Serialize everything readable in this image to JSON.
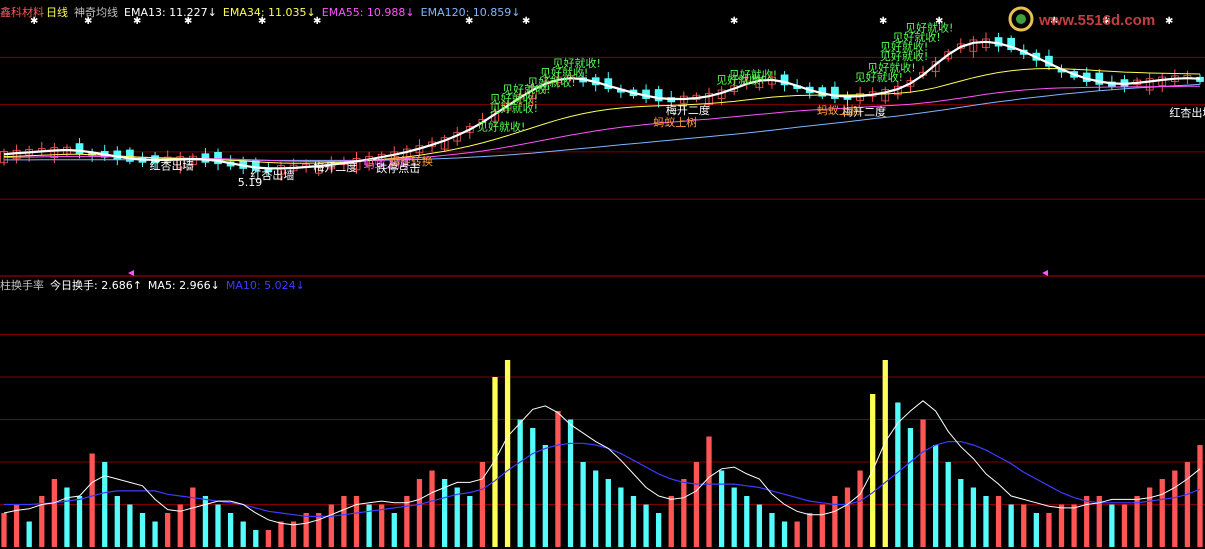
{
  "header_top": {
    "stock_name": "鑫科材料",
    "period": "日线",
    "indicator": "神奇均线",
    "ema13": "EMA13: 11.227↓",
    "ema34": "EMA34: 11.035↓",
    "ema55": "EMA55: 10.988↓",
    "ema120": "EMA120: 10.859↓"
  },
  "header_bottom": {
    "title": "柱换手率",
    "today": "今日换手: 2.686↑",
    "ma5": "MA5: 2.966↓",
    "ma10": "MA10: 5.024↓"
  },
  "watermark": {
    "text": "www.5516d.com"
  },
  "colors": {
    "up": "#ff5555",
    "down": "#54fcfc",
    "ema13": "#ffffff",
    "ema34": "#ffff54",
    "ema55": "#ff54ff",
    "ema120": "#7fb6ff",
    "signal_green": "#54fc54",
    "signal_white": "#ffffff",
    "signal_orange": "#ff9c3c",
    "signal_magenta": "#ff54ff",
    "grid": "#800000",
    "vol_ma5": "#ffffff",
    "vol_ma10": "#3c3cff",
    "vol_high": "#ffff54"
  },
  "chart_data": [
    {
      "type": "candlestick",
      "title": "",
      "ylim": [
        5.0,
        15.5
      ],
      "ema13": [
        9.9,
        9.95,
        9.98,
        10.02,
        10.06,
        10.08,
        10.05,
        9.98,
        9.9,
        9.8,
        9.72,
        9.68,
        9.66,
        9.66,
        9.68,
        9.7,
        9.68,
        9.62,
        9.52,
        9.42,
        9.34,
        9.3,
        9.3,
        9.32,
        9.36,
        9.4,
        9.46,
        9.52,
        9.6,
        9.68,
        9.78,
        9.88,
        10.0,
        10.14,
        10.3,
        10.48,
        10.7,
        10.95,
        11.25,
        11.6,
        11.95,
        12.3,
        12.62,
        12.88,
        13.05,
        13.12,
        13.08,
        12.96,
        12.8,
        12.65,
        12.5,
        12.38,
        12.28,
        12.24,
        12.24,
        12.28,
        12.36,
        12.5,
        12.68,
        12.88,
        13.02,
        13.05,
        12.96,
        12.8,
        12.62,
        12.48,
        12.38,
        12.34,
        12.36,
        12.42,
        12.52,
        12.66,
        12.9,
        13.25,
        13.7,
        14.12,
        14.45,
        14.62,
        14.66,
        14.6,
        14.45,
        14.25,
        14.0,
        13.75,
        13.5,
        13.28,
        13.1,
        12.98,
        12.9,
        12.88,
        12.92,
        12.98,
        13.05,
        13.1,
        13.12,
        13.1
      ],
      "ema34": [
        9.8,
        9.82,
        9.84,
        9.86,
        9.88,
        9.9,
        9.9,
        9.88,
        9.86,
        9.83,
        9.8,
        9.77,
        9.75,
        9.73,
        9.72,
        9.71,
        9.7,
        9.68,
        9.65,
        9.62,
        9.58,
        9.55,
        9.53,
        9.52,
        9.52,
        9.53,
        9.55,
        9.57,
        9.6,
        9.64,
        9.68,
        9.73,
        9.79,
        9.86,
        9.94,
        10.03,
        10.13,
        10.25,
        10.38,
        10.53,
        10.69,
        10.86,
        11.03,
        11.2,
        11.36,
        11.5,
        11.62,
        11.72,
        11.8,
        11.86,
        11.9,
        11.93,
        11.95,
        11.97,
        11.99,
        12.02,
        12.05,
        12.09,
        12.14,
        12.2,
        12.26,
        12.32,
        12.36,
        12.39,
        12.4,
        12.41,
        12.41,
        12.41,
        12.42,
        12.43,
        12.45,
        12.48,
        12.53,
        12.61,
        12.72,
        12.86,
        13.0,
        13.14,
        13.26,
        13.36,
        13.44,
        13.49,
        13.52,
        13.53,
        13.52,
        13.5,
        13.47,
        13.44,
        13.41,
        13.38,
        13.36,
        13.34,
        13.33,
        13.32,
        13.31,
        13.3
      ],
      "ema55": [
        9.76,
        9.77,
        9.78,
        9.79,
        9.8,
        9.81,
        9.81,
        9.81,
        9.8,
        9.79,
        9.78,
        9.77,
        9.76,
        9.75,
        9.74,
        9.73,
        9.72,
        9.71,
        9.7,
        9.68,
        9.66,
        9.64,
        9.62,
        9.61,
        9.6,
        9.6,
        9.6,
        9.61,
        9.62,
        9.64,
        9.66,
        9.69,
        9.72,
        9.76,
        9.8,
        9.85,
        9.91,
        9.97,
        10.04,
        10.12,
        10.21,
        10.31,
        10.41,
        10.51,
        10.61,
        10.71,
        10.8,
        10.89,
        10.97,
        11.04,
        11.1,
        11.16,
        11.21,
        11.26,
        11.3,
        11.35,
        11.39,
        11.44,
        11.49,
        11.54,
        11.59,
        11.64,
        11.69,
        11.73,
        11.77,
        11.8,
        11.83,
        11.86,
        11.89,
        11.92,
        11.95,
        11.98,
        12.02,
        12.07,
        12.13,
        12.2,
        12.28,
        12.36,
        12.44,
        12.51,
        12.57,
        12.62,
        12.66,
        12.69,
        12.71,
        12.72,
        12.73,
        12.74,
        12.75,
        12.75,
        12.76,
        12.76,
        12.77,
        12.77,
        12.78,
        12.78
      ],
      "ema120": [
        9.66,
        9.66,
        9.66,
        9.67,
        9.67,
        9.67,
        9.67,
        9.67,
        9.67,
        9.67,
        9.67,
        9.67,
        9.67,
        9.66,
        9.66,
        9.66,
        9.66,
        9.66,
        9.65,
        9.65,
        9.65,
        9.64,
        9.64,
        9.64,
        9.64,
        9.64,
        9.64,
        9.64,
        9.64,
        9.65,
        9.65,
        9.66,
        9.67,
        9.68,
        9.7,
        9.72,
        9.74,
        9.77,
        9.8,
        9.83,
        9.87,
        9.91,
        9.95,
        10.0,
        10.05,
        10.1,
        10.15,
        10.2,
        10.25,
        10.3,
        10.35,
        10.4,
        10.45,
        10.5,
        10.55,
        10.6,
        10.65,
        10.7,
        10.75,
        10.8,
        10.86,
        10.92,
        10.98,
        11.04,
        11.1,
        11.16,
        11.22,
        11.28,
        11.34,
        11.4,
        11.46,
        11.52,
        11.59,
        11.66,
        11.73,
        11.81,
        11.89,
        11.97,
        12.05,
        12.12,
        12.19,
        12.26,
        12.32,
        12.38,
        12.44,
        12.49,
        12.54,
        12.59,
        12.63,
        12.67,
        12.71,
        12.74,
        12.77,
        12.8,
        12.83,
        12.86
      ],
      "annotations": [
        {
          "text": "见好就收!",
          "color": "green",
          "i": 45,
          "y": 13.6
        },
        {
          "text": "见好就收!",
          "color": "green",
          "i": 44,
          "y": 13.2
        },
        {
          "text": "见好就收!",
          "color": "green",
          "i": 43,
          "y": 12.8
        },
        {
          "text": "见好就收!",
          "color": "green",
          "i": 41,
          "y": 12.5
        },
        {
          "text": "见好就收!",
          "color": "green",
          "i": 40,
          "y": 12.1
        },
        {
          "text": "见好就收!",
          "color": "green",
          "i": 40,
          "y": 11.7
        },
        {
          "text": "见好就收!",
          "color": "green",
          "i": 39,
          "y": 10.9
        },
        {
          "text": "见好就收!",
          "color": "green",
          "i": 59,
          "y": 13.1
        },
        {
          "text": "见好就收!",
          "color": "green",
          "i": 58,
          "y": 12.9
        },
        {
          "text": "见好就收!",
          "color": "green",
          "i": 73,
          "y": 15.1
        },
        {
          "text": "见好就收!",
          "color": "green",
          "i": 72,
          "y": 14.7
        },
        {
          "text": "见好就收!",
          "color": "green",
          "i": 71,
          "y": 14.3
        },
        {
          "text": "见好就收!",
          "color": "green",
          "i": 71,
          "y": 13.9
        },
        {
          "text": "见好就收!",
          "color": "green",
          "i": 70,
          "y": 13.4
        },
        {
          "text": "见好就收!",
          "color": "green",
          "i": 69,
          "y": 13.0
        },
        {
          "text": "红杏出墙",
          "color": "white",
          "i": 13,
          "y": 9.25
        },
        {
          "text": "红杏出墙",
          "color": "white",
          "i": 21,
          "y": 8.85
        },
        {
          "text": "梅开二度",
          "color": "white",
          "i": 26,
          "y": 9.2
        },
        {
          "text": "梅开二度",
          "color": "white",
          "i": 54,
          "y": 11.6
        },
        {
          "text": "梅开二度",
          "color": "white",
          "i": 68,
          "y": 11.55
        },
        {
          "text": "红杏出墙",
          "color": "white",
          "i": 94,
          "y": 11.5
        },
        {
          "text": "梅开二度",
          "color": "white",
          "i": 98,
          "y": 12.3
        },
        {
          "text": "红杏出墙",
          "color": "white",
          "i": 98,
          "y": 11.9
        },
        {
          "text": "蚂蚁上树",
          "color": "orange",
          "i": 53,
          "y": 11.1
        },
        {
          "text": "蚂蚁上树",
          "color": "orange",
          "i": 66,
          "y": 11.6
        },
        {
          "text": "蚂蚁上树",
          "color": "orange",
          "i": 101,
          "y": 12.5
        },
        {
          "text": "蚂蚁上树",
          "color": "magenta",
          "i": 30,
          "y": 9.35
        },
        {
          "text": "螺旋转换",
          "color": "orange",
          "i": 32,
          "y": 9.45
        },
        {
          "text": "跌停点击",
          "color": "white",
          "i": 31,
          "y": 9.15
        },
        {
          "text": "5.19",
          "color": "white",
          "i": 20,
          "y": 8.55
        }
      ]
    },
    {
      "type": "bar",
      "title": "",
      "ylim": [
        0,
        30
      ],
      "values": [
        4,
        5,
        3,
        6,
        8,
        7,
        6,
        11,
        10,
        6,
        5,
        4,
        3,
        4,
        5,
        7,
        6,
        5,
        4,
        3,
        2,
        2,
        3,
        3,
        4,
        4,
        5,
        6,
        6,
        5,
        5,
        4,
        6,
        8,
        9,
        8,
        7,
        6,
        10,
        20,
        22,
        15,
        14,
        12,
        16,
        15,
        10,
        9,
        8,
        7,
        6,
        5,
        4,
        6,
        8,
        10,
        13,
        9,
        7,
        6,
        5,
        4,
        3,
        3,
        4,
        5,
        6,
        7,
        9,
        18,
        22,
        17,
        14,
        15,
        12,
        10,
        8,
        7,
        6,
        6,
        5,
        5,
        4,
        4,
        5,
        5,
        6,
        6,
        5,
        5,
        6,
        7,
        8,
        9,
        10,
        12
      ],
      "ma5": [
        4.0,
        4.3,
        4.5,
        5.0,
        5.2,
        5.8,
        6.0,
        7.6,
        8.4,
        8.0,
        7.6,
        7.2,
        5.6,
        4.4,
        4.2,
        4.6,
        5.0,
        5.4,
        5.4,
        5.0,
        4.0,
        3.2,
        2.8,
        2.6,
        2.8,
        3.2,
        3.8,
        4.4,
        5.0,
        5.2,
        5.4,
        5.2,
        5.2,
        5.6,
        6.4,
        7.0,
        7.6,
        7.6,
        8.0,
        10.2,
        13.0,
        14.6,
        16.2,
        16.6,
        15.8,
        14.4,
        13.4,
        12.4,
        11.6,
        10.2,
        8.6,
        7.0,
        6.0,
        5.6,
        5.8,
        6.6,
        8.2,
        9.2,
        9.4,
        8.6,
        8.0,
        6.2,
        5.0,
        4.2,
        3.8,
        3.8,
        4.2,
        5.0,
        6.2,
        9.0,
        12.4,
        14.6,
        16.0,
        17.2,
        16.0,
        13.6,
        11.8,
        10.4,
        8.6,
        7.4,
        6.0,
        5.6,
        5.2,
        4.8,
        4.6,
        4.6,
        5.0,
        5.2,
        5.6,
        5.6,
        5.6,
        5.8,
        6.2,
        7.0,
        8.0,
        9.2
      ],
      "ma10": [
        5.0,
        5.0,
        5.0,
        5.1,
        5.2,
        5.4,
        5.6,
        6.0,
        6.4,
        6.6,
        6.6,
        6.6,
        6.6,
        6.2,
        6.0,
        5.8,
        5.6,
        5.4,
        5.2,
        5.0,
        4.6,
        4.2,
        4.0,
        3.8,
        3.6,
        3.6,
        3.6,
        3.8,
        4.0,
        4.2,
        4.4,
        4.6,
        4.8,
        5.0,
        5.4,
        5.8,
        6.2,
        6.4,
        6.8,
        7.8,
        9.0,
        10.0,
        11.0,
        11.6,
        12.0,
        12.2,
        12.2,
        12.0,
        11.6,
        11.0,
        10.2,
        9.4,
        8.6,
        8.0,
        7.6,
        7.4,
        7.4,
        7.4,
        7.4,
        7.2,
        7.0,
        6.6,
        6.2,
        5.8,
        5.4,
        5.2,
        5.0,
        5.0,
        5.4,
        6.4,
        7.6,
        8.8,
        10.0,
        11.2,
        12.0,
        12.4,
        12.4,
        12.0,
        11.4,
        10.6,
        9.8,
        8.8,
        8.0,
        7.2,
        6.4,
        5.8,
        5.4,
        5.2,
        5.2,
        5.2,
        5.2,
        5.4,
        5.6,
        5.8,
        6.2,
        6.8
      ]
    }
  ]
}
